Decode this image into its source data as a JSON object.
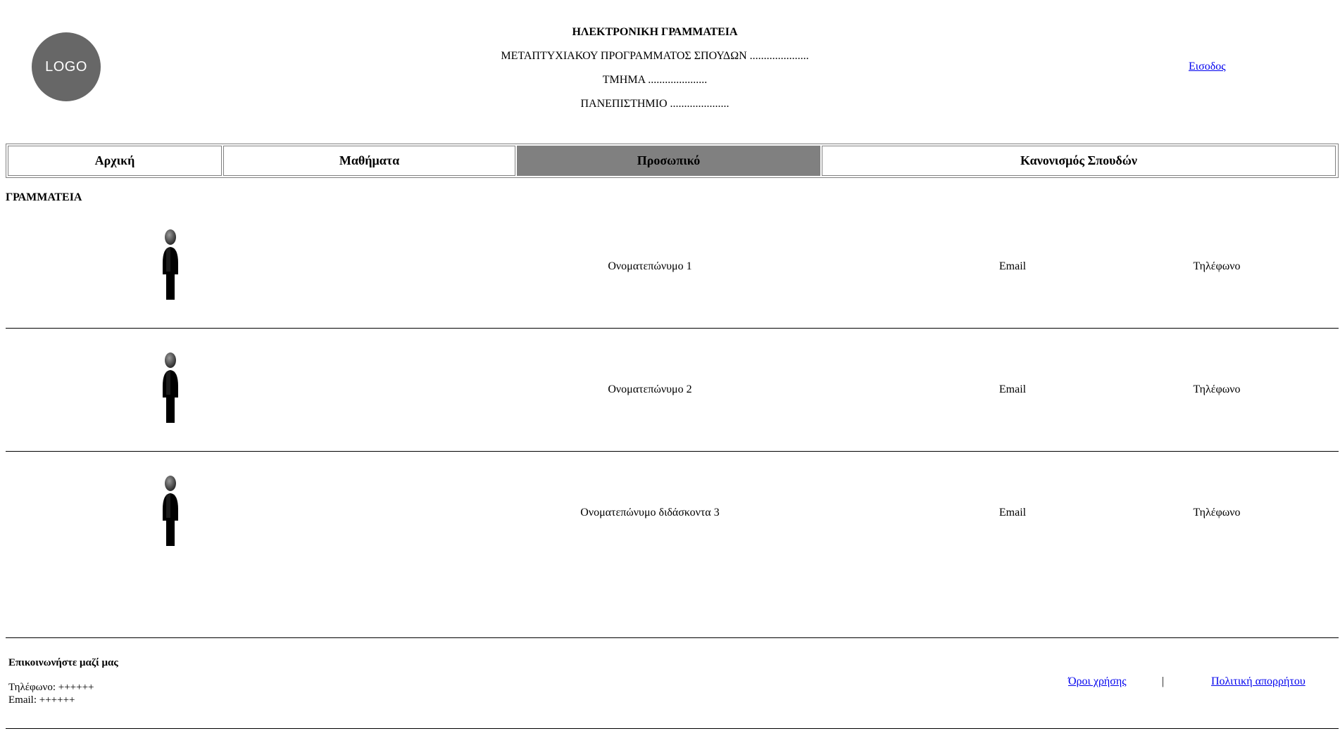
{
  "header": {
    "logo_text": "LOGO",
    "title": "ΗΛΕΚΤΡΟΝΙΚΗ ΓΡΑΜΜΑΤΕΙΑ",
    "program": "ΜΕΤΑΠΤΥΧΙΑΚΟΥ ΠΡΟΓΡΑΜΜΑΤΟΣ ΣΠΟΥΔΩΝ .....................",
    "department": "ΤΜΗΜΑ .....................",
    "university": "ΠΑΝΕΠΙΣΤΗΜΙΟ .....................",
    "login_label": "Εισοδος"
  },
  "nav": {
    "items": [
      {
        "label": "Αρχική"
      },
      {
        "label": "Μαθήματα"
      },
      {
        "label": "Προσωπικό"
      },
      {
        "label": "Κανονισμός Σπουδών"
      }
    ],
    "active": "Προσωπικό"
  },
  "section": {
    "title": "ΓΡΑΜΜΑΤΕΙΑ",
    "staff": [
      {
        "name": "Ονοματεπώνυμο 1",
        "email": "Email",
        "phone": "Τηλέφωνο",
        "icon": "person-icon"
      },
      {
        "name": "Ονοματεπώνυμο 2",
        "email": "Email",
        "phone": "Τηλέφωνο",
        "icon": "person-icon"
      },
      {
        "name": "Ονοματεπώνυμο διδάσκοντα 3",
        "email": "Email",
        "phone": "Τηλέφωνο",
        "icon": "person-icon"
      }
    ]
  },
  "footer": {
    "contact_title": "Επικοινωνήστε μαζί μας",
    "phone_line": "Τηλέφωνο: ++++++",
    "email_line": "Email: ++++++",
    "terms_label": "Όροι χρήσης",
    "separator": "|",
    "privacy_label": "Πολιτική απορρήτου"
  },
  "colors": {
    "logo_bg": "#676767",
    "nav_active_bg": "#808080",
    "link": "#0000ee"
  }
}
